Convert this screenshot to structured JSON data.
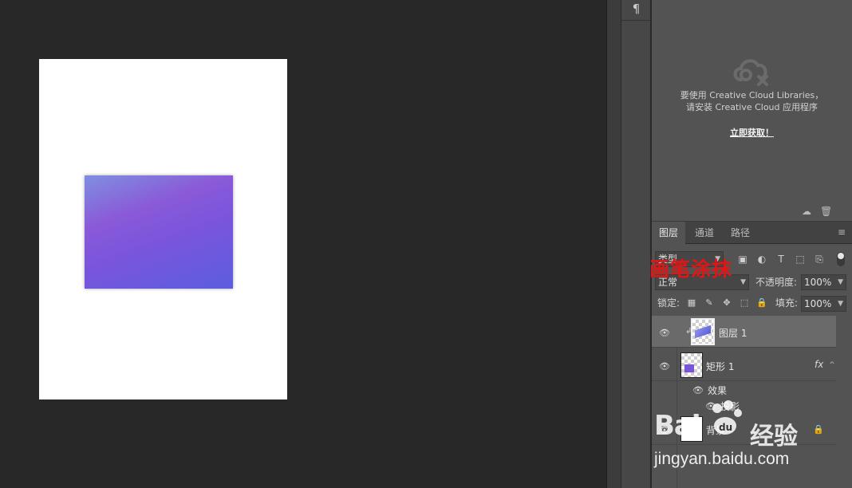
{
  "panel_toggle": {
    "paragraph_glyph": "¶"
  },
  "libraries": {
    "line1": "要使用 Creative Cloud Libraries，",
    "line2": "请安装 Creative Cloud 应用程序",
    "link": "立即获取！"
  },
  "layers_panel": {
    "tabs": [
      "图层",
      "通道",
      "路径"
    ],
    "filter_kind": "类型",
    "blend_mode": "正常",
    "opacity_label": "不透明度:",
    "opacity_value": "100%",
    "lock_label": "锁定:",
    "fill_label": "填充:",
    "fill_value": "100%",
    "layers": [
      {
        "name": "图层 1",
        "selected": true
      },
      {
        "name": "矩形 1",
        "fx": "fx"
      },
      {
        "name": "效果"
      },
      {
        "name": "投影"
      },
      {
        "name": "背景",
        "locked": true
      }
    ]
  },
  "annotation": {
    "text": "画笔涂抹",
    "color": "#e31414"
  },
  "watermark": {
    "logo": "Bai",
    "logo_suffix": "du",
    "brand": "经验",
    "url": "jingyan.baidu.com"
  },
  "colors": {
    "canvas_bg": "#282828",
    "panel_bg": "#535353",
    "shape_gradient_top": "#7f8fe0",
    "shape_gradient_mid": "#8a5ad8",
    "shape_gradient_bottom": "#5c5ddf"
  }
}
